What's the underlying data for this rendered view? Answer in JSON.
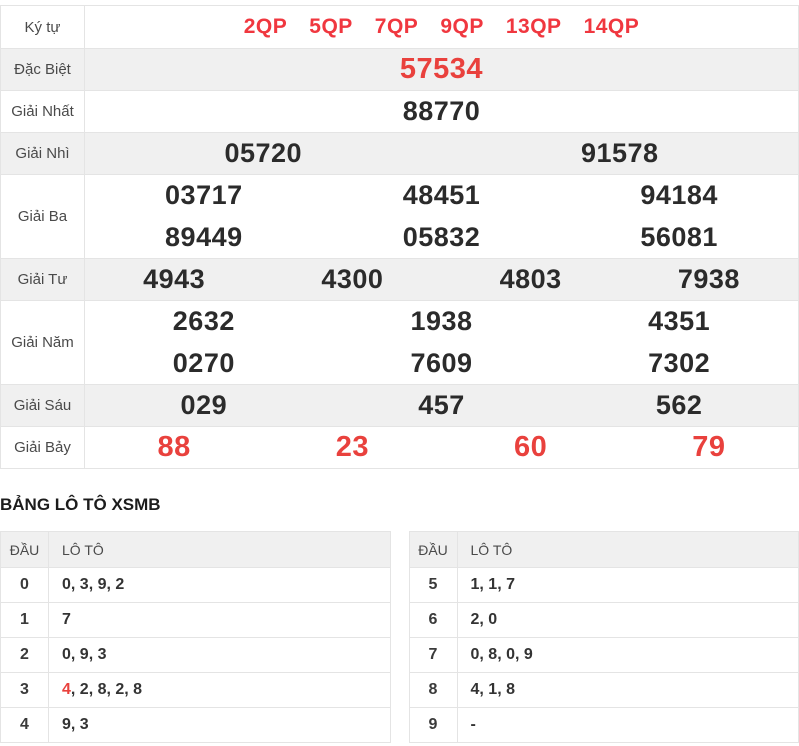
{
  "colors": {
    "code_red": "#f0373f",
    "number_red": "#e9413d",
    "shaded_row_bg": "#f0f0f0",
    "border": "#e4e4e4"
  },
  "results_table": {
    "rows": [
      {
        "label": "Ký tự",
        "type": "codes",
        "shaded": false,
        "red": true,
        "values": [
          "2QP",
          "5QP",
          "7QP",
          "9QP",
          "13QP",
          "14QP"
        ]
      },
      {
        "label": "Đặc Biệt",
        "shaded": true,
        "red": true,
        "big": true,
        "values": [
          "57534"
        ]
      },
      {
        "label": "Giải Nhất",
        "shaded": false,
        "red": false,
        "values": [
          "88770"
        ]
      },
      {
        "label": "Giải Nhì",
        "shaded": true,
        "red": false,
        "values": [
          "05720",
          "91578"
        ]
      },
      {
        "label": "Giải Ba",
        "shaded": false,
        "red": false,
        "cols": 3,
        "values": [
          "03717",
          "48451",
          "94184",
          "89449",
          "05832",
          "56081"
        ]
      },
      {
        "label": "Giải Tư",
        "shaded": true,
        "red": false,
        "values": [
          "4943",
          "4300",
          "4803",
          "7938"
        ]
      },
      {
        "label": "Giải Năm",
        "shaded": false,
        "red": false,
        "cols": 3,
        "values": [
          "2632",
          "1938",
          "4351",
          "0270",
          "7609",
          "7302"
        ]
      },
      {
        "label": "Giải Sáu",
        "shaded": true,
        "red": false,
        "values": [
          "029",
          "457",
          "562"
        ]
      },
      {
        "label": "Giải Bảy",
        "shaded": false,
        "red": true,
        "big": true,
        "values": [
          "88",
          "23",
          "60",
          "79"
        ]
      }
    ]
  },
  "loto": {
    "heading": "BẢNG LÔ TÔ XSMB",
    "col_dau": "ĐẦU",
    "col_loto": "LÔ TÔ",
    "left_rows": [
      {
        "dau": "0",
        "parts": [
          {
            "text": "0, 3, 9, 2",
            "red": false
          }
        ]
      },
      {
        "dau": "1",
        "parts": [
          {
            "text": "7",
            "red": false
          }
        ]
      },
      {
        "dau": "2",
        "parts": [
          {
            "text": "0, 9, 3",
            "red": false
          }
        ]
      },
      {
        "dau": "3",
        "parts": [
          {
            "text": "4",
            "red": true
          },
          {
            "text": ", 2, 8, 2, 8",
            "red": false
          }
        ]
      },
      {
        "dau": "4",
        "parts": [
          {
            "text": "9, 3",
            "red": false
          }
        ]
      }
    ],
    "right_rows": [
      {
        "dau": "5",
        "parts": [
          {
            "text": "1, 1, 7",
            "red": false
          }
        ]
      },
      {
        "dau": "6",
        "parts": [
          {
            "text": "2, 0",
            "red": false
          }
        ]
      },
      {
        "dau": "7",
        "parts": [
          {
            "text": "0, 8, 0, 9",
            "red": false
          }
        ]
      },
      {
        "dau": "8",
        "parts": [
          {
            "text": "4, 1, 8",
            "red": false
          }
        ]
      },
      {
        "dau": "9",
        "parts": [
          {
            "text": "-",
            "red": false
          }
        ]
      }
    ]
  }
}
